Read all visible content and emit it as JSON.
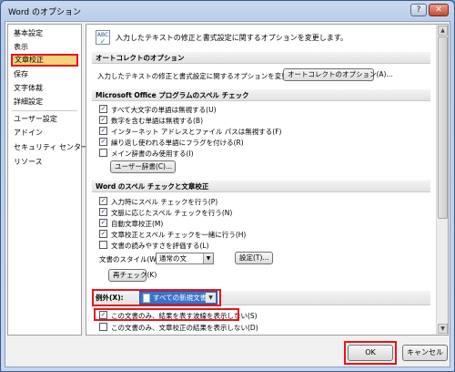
{
  "window": {
    "title": "Word のオプション",
    "help_glyph": "?",
    "close_glyph": "✕"
  },
  "sidebar": {
    "items": [
      {
        "label": "基本設定"
      },
      {
        "label": "表示"
      },
      {
        "label": "文章校正",
        "selected": true
      },
      {
        "label": "保存"
      },
      {
        "label": "文字体裁"
      },
      {
        "label": "詳細設定"
      },
      {
        "label": "ユーザー設定"
      },
      {
        "label": "アドイン"
      },
      {
        "label": "セキュリティ センター"
      },
      {
        "label": "リソース"
      }
    ]
  },
  "header": {
    "icon_text": "ABC",
    "text": "入力したテキストの修正と書式設定に関するオプションを変更します。"
  },
  "autocorrect": {
    "title": "オートコレクトのオプション",
    "description": "入力したテキストの修正と書式設定に関するオプションを変更します:",
    "button": "オートコレクトのオプション(A)..."
  },
  "office_spelling": {
    "title": "Microsoft Office プログラムのスペル チェック",
    "options": [
      {
        "label": "すべて大文字の単語は無視する(U)",
        "checked": true
      },
      {
        "label": "数字を含む単語は無視する(B)",
        "checked": true
      },
      {
        "label": "インターネット アドレスとファイル パスは無視する(F)",
        "checked": true
      },
      {
        "label": "繰り返し使われる単語にフラグを付ける(R)",
        "checked": true
      },
      {
        "label": "メイン辞書のみ使用する(I)",
        "checked": false
      }
    ],
    "dictionary_button": "ユーザー辞書(C)..."
  },
  "word_spelling": {
    "title": "Word のスペル チェックと文章校正",
    "options": [
      {
        "label": "入力時にスペル チェックを行う(P)",
        "checked": true
      },
      {
        "label": "文脈に応じたスペル チェックを行う(N)",
        "checked": true
      },
      {
        "label": "自動文章校正(M)",
        "checked": true
      },
      {
        "label": "文章校正とスペル チェックを一緒に行う(H)",
        "checked": true
      },
      {
        "label": "文書の読みやすさを評価する(L)",
        "checked": false
      }
    ],
    "style_label": "文書のスタイル(W):",
    "style_value": "通常の文",
    "settings_button": "設定(T)...",
    "recheck_button": "再チェック(K)"
  },
  "exceptions": {
    "label": "例外(X):",
    "selected": "すべての新規文書",
    "options": [
      {
        "label": "この文書のみ、結果を表す波線を表示しない(S)",
        "checked": true
      },
      {
        "label": "この文書のみ、文章校正の結果を表示しない(D)",
        "checked": false
      }
    ]
  },
  "footer": {
    "ok": "OK",
    "cancel": "キャンセル"
  },
  "colors": {
    "highlight": "#e8131c",
    "selected_bg": "#f6d27a",
    "dropdown": "#3b73c8"
  },
  "scrollbar": {
    "up_glyph": "▲",
    "down_glyph": "▼"
  },
  "dropdown_glyph": "▼"
}
